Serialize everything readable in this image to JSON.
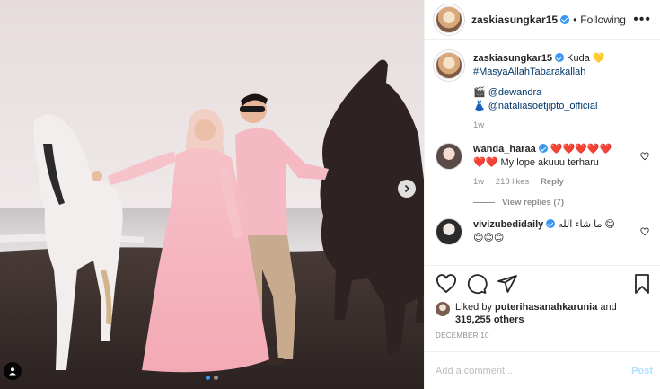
{
  "header": {
    "username": "zaskiasungkar15",
    "separator": "•",
    "follow_status": "Following",
    "more_icon": "more-horizontal-icon"
  },
  "caption": {
    "username": "zaskiasungkar15",
    "text": "Kuda",
    "emoji": "💛",
    "hashtag": "#MasyaAllahTabarakallah",
    "credit1_emoji": "🎬",
    "credit1_mention": "@dewandra",
    "credit2_emoji": "👗",
    "credit2_mention": "@nataliasoetjipto_official",
    "time": "1w"
  },
  "comments": [
    {
      "username": "wanda_haraa",
      "line1": "❤️❤️❤️❤️❤️",
      "line2_emoji": "❤️❤️",
      "line2_text": "My lope akuuu terharu",
      "time": "1w",
      "likes": "218 likes",
      "reply": "Reply",
      "view_replies": "View replies (7)"
    },
    {
      "username": "vivizubedidaily",
      "text": "ما شاء الله",
      "emoji1": "😋",
      "line2": "😊😊😊"
    }
  ],
  "actions": {
    "like_icon": "heart-outline-icon",
    "comment_icon": "comment-icon",
    "share_icon": "send-icon",
    "save_icon": "bookmark-icon"
  },
  "likes": {
    "prefix": "Liked by",
    "user": "puterihasanahkarunia",
    "and": "and",
    "count": "319,255 others"
  },
  "date": "DECEMBER 10",
  "add_comment": {
    "placeholder": "Add a comment...",
    "post_label": "Post"
  },
  "carousel": {
    "total_slides": 2,
    "active_slide": 1
  },
  "colors": {
    "accent": "#3897f0",
    "link": "#00376b",
    "muted": "#8e8e8e",
    "heart": "#ed4956",
    "post_disabled": "#b2dffc"
  }
}
